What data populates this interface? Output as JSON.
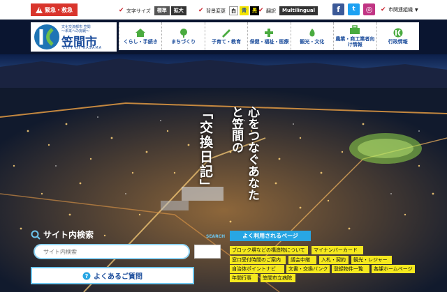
{
  "topbar": {
    "emergency": "緊急・救急",
    "text_size_label": "文字サイズ",
    "text_size_standard": "標準",
    "text_size_large": "拡大",
    "bg_color_label": "背景変更",
    "color_white": "白",
    "color_yellow": "青",
    "color_black": "黒",
    "translate_label": "翻訳",
    "multilingual": "Multilingual",
    "related_orgs": "市関連組織"
  },
  "logo": {
    "tagline_1": "文化交流都市 笠間",
    "tagline_2": "～未来への挑戦～",
    "city_name": "笠間市",
    "city_name_en": "CITY OF KASAMA"
  },
  "nav": {
    "items": [
      {
        "label": "くらし・手続き",
        "icon": "house-icon"
      },
      {
        "label": "まちづくり",
        "icon": "tree-icon"
      },
      {
        "label": "子育て・教育",
        "icon": "pencil-icon"
      },
      {
        "label": "保健・福祉・医療",
        "icon": "medical-icon"
      },
      {
        "label": "観光・文化",
        "icon": "flame-icon"
      },
      {
        "label": "農業・商工業者向け情報",
        "icon": "briefcase-icon"
      },
      {
        "label": "行政情報",
        "icon": "logo-k-icon"
      }
    ]
  },
  "hero": {
    "slogan_main": "心をつなぐあなたと笠間の",
    "slogan_bracket": "「交換日記」"
  },
  "search": {
    "title": "サイト内検索",
    "placeholder": "サイト内検索",
    "button_label": "SEARCH",
    "faq": "よくあるご質問"
  },
  "quicklinks": {
    "heading": "よく利用されるページ",
    "items": [
      "ブロック塀などの構造物について",
      "マイナンバーカード",
      "窓口受付時間のご案内",
      "議会中継",
      "入札・契約",
      "観光・レジャー",
      "自治体ポイントナビ",
      "文書・交換バンク",
      "登録物件一覧",
      "各課ホームページ",
      "年間行事",
      "笠間市立病院"
    ]
  },
  "colors": {
    "accent": "#d9352c",
    "brand_blue": "#1c4d9c",
    "quicklink_yellow": "#f4e81e",
    "faq_blue": "#28a6e3"
  }
}
